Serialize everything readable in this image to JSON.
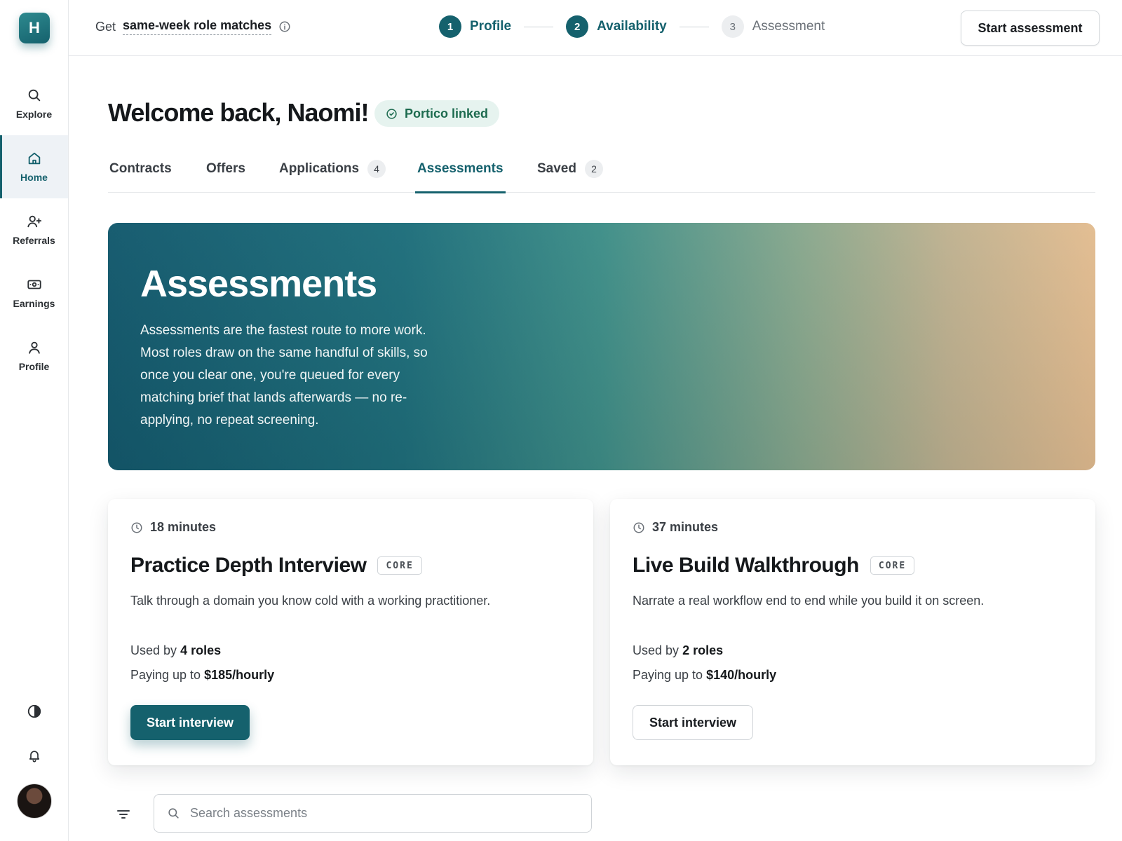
{
  "brand": {
    "logo_text": "H"
  },
  "sidebar": {
    "items": [
      {
        "label": "Explore"
      },
      {
        "label": "Home"
      },
      {
        "label": "Referrals"
      },
      {
        "label": "Earnings"
      },
      {
        "label": "Profile"
      }
    ],
    "bottom_icons": [
      "contrast-icon",
      "bell-icon",
      "avatar"
    ]
  },
  "topbar": {
    "promo_prefix": "Get",
    "promo_emphasis": "same-week role matches",
    "steps": [
      {
        "num": "1",
        "label": "Profile",
        "state": "done"
      },
      {
        "num": "2",
        "label": "Availability",
        "state": "done"
      },
      {
        "num": "3",
        "label": "Assessment",
        "state": "pending"
      }
    ],
    "action_label": "Start assessment"
  },
  "page": {
    "welcome": "Welcome back, Naomi!",
    "linked_badge": "Portico linked"
  },
  "tabs": [
    {
      "label": "Contracts",
      "count": null
    },
    {
      "label": "Offers",
      "count": null
    },
    {
      "label": "Applications",
      "count": "4"
    },
    {
      "label": "Assessments",
      "count": null,
      "active": true
    },
    {
      "label": "Saved",
      "count": "2"
    }
  ],
  "hero": {
    "title": "Assessments",
    "text": "Assessments are the fastest route to more work. Most roles draw on the same handful of skills, so once you clear one, you're queued for every matching brief that lands afterwards — no re-applying, no repeat screening."
  },
  "cards": [
    {
      "duration": "18 minutes",
      "title": "Practice Depth Interview",
      "tag": "CORE",
      "description": "Talk through a domain you know cold with a working practitioner.",
      "used_prefix": "Used by",
      "used_value": "4 roles",
      "pay_prefix": "Paying up to",
      "pay_value": "$185/hourly",
      "cta": "Start interview"
    },
    {
      "duration": "37 minutes",
      "title": "Live Build Walkthrough",
      "tag": "CORE",
      "description": "Narrate a real workflow end to end while you build it on screen.",
      "used_prefix": "Used by",
      "used_value": "2 roles",
      "pay_prefix": "Paying up to",
      "pay_value": "$140/hourly",
      "cta": "Start interview"
    }
  ],
  "search": {
    "placeholder": "Search assessments",
    "value": ""
  },
  "colors": {
    "accent": "#15616d",
    "badge_bg": "#e6f3ef",
    "badge_text": "#1d6b4f"
  }
}
